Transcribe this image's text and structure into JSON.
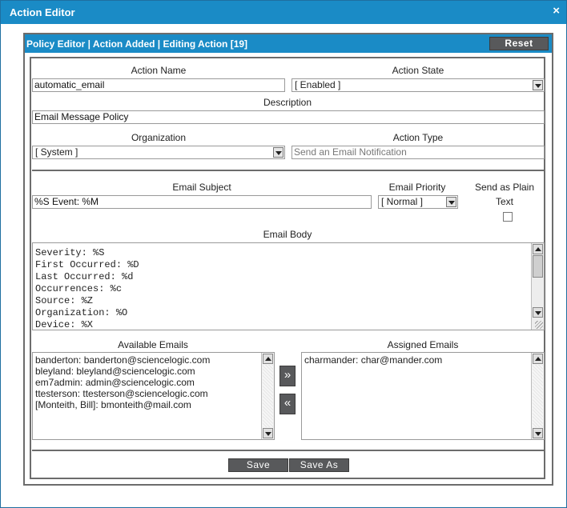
{
  "window": {
    "title": "Action Editor",
    "close_glyph": "×"
  },
  "panel": {
    "title": "Policy Editor | Action Added | Editing Action [19]",
    "reset_label": "Reset"
  },
  "fields": {
    "action_name": {
      "label": "Action Name",
      "value": "automatic_email"
    },
    "action_state": {
      "label": "Action State",
      "value": "[ Enabled ]"
    },
    "description": {
      "label": "Description",
      "value": "Email Message Policy"
    },
    "organization": {
      "label": "Organization",
      "value": "[ System ]"
    },
    "action_type": {
      "label": "Action Type",
      "value": "Send an Email Notification"
    }
  },
  "email": {
    "subject_label": "Email Subject",
    "subject_value": "%S Event: %M",
    "priority_label": "Email Priority",
    "priority_value": "[ Normal ]",
    "plain_label_1": "Send as Plain",
    "plain_label_2": "Text",
    "plain_checked": false,
    "body_label": "Email Body",
    "body_lines": [
      "Severity: %S",
      "First Occurred: %D",
      "Last Occurred: %d",
      "Occurrences: %c",
      "Source: %Z",
      "Organization: %O",
      "Device: %X"
    ]
  },
  "available": {
    "label": "Available Emails",
    "items": [
      "banderton: banderton@sciencelogic.com",
      "bleyland: bleyland@sciencelogic.com",
      "em7admin: admin@sciencelogic.com",
      "ttesterson: ttesterson@sciencelogic.com",
      "[Monteith, Bill]: bmonteith@mail.com"
    ]
  },
  "assigned": {
    "label": "Assigned Emails",
    "items": [
      "charmander: char@mander.com"
    ]
  },
  "movers": {
    "add_glyph": "»",
    "remove_glyph": "«"
  },
  "footer": {
    "save_label": "Save",
    "save_as_label": "Save As"
  },
  "colors": {
    "accent": "#1a8bc6",
    "button": "#58595b",
    "border": "#6c6c6c"
  },
  "icons": {
    "close": "close-icon",
    "dropdown": "chevron-down-icon",
    "add": "double-chevron-right-icon",
    "remove": "double-chevron-left-icon"
  }
}
